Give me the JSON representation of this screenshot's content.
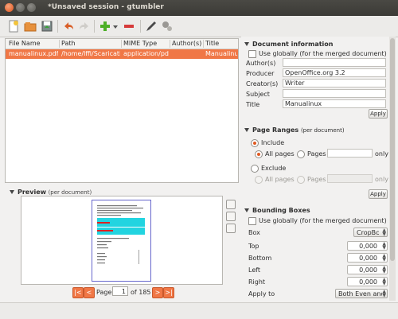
{
  "window": {
    "title": "*Unsaved session - gtumbler"
  },
  "toolbar": {
    "icons": [
      "new-icon",
      "open-icon",
      "save-icon",
      "undo-icon",
      "redo-icon",
      "add-icon",
      "add-menu-icon",
      "remove-icon",
      "edit-icon",
      "settings-icon"
    ]
  },
  "filelist": {
    "columns": [
      "File Name",
      "Path",
      "MIME Type",
      "Author(s)",
      "Title"
    ],
    "rows": [
      {
        "file": "manualinux.pdf",
        "path": "/home/lffi/Scaricati",
        "mime": "application/pdf",
        "author": "",
        "title": "Manualinux"
      }
    ]
  },
  "preview": {
    "label": "Preview",
    "note": "(per document)",
    "page_label": "Page",
    "page_value": "1",
    "of_label": "of 185"
  },
  "docinfo": {
    "header": "Document information",
    "use_globally": "Use globally (for the merged document)",
    "fields": [
      {
        "key": "Author(s)",
        "value": ""
      },
      {
        "key": "Producer",
        "value": "OpenOffice.org 3.2"
      },
      {
        "key": "Creator(s)",
        "value": "Writer"
      },
      {
        "key": "Subject",
        "value": ""
      },
      {
        "key": "Title",
        "value": "Manualinux"
      }
    ],
    "apply": "Apply"
  },
  "ranges": {
    "header": "Page Ranges",
    "note": "(per document)",
    "include": "Include",
    "all_pages": "All pages",
    "pages": "Pages",
    "only": "only",
    "exclude": "Exclude",
    "all_pages2": "All pages",
    "pages2": "Pages",
    "only2": "only",
    "apply": "Apply"
  },
  "bbox": {
    "header": "Bounding Boxes",
    "use_globally": "Use globally (for the merged document)",
    "box_label": "Box",
    "box_value": "CropBc",
    "top_label": "Top",
    "top_value": "0,000",
    "bottom_label": "Bottom",
    "bottom_value": "0,000",
    "left_label": "Left",
    "left_value": "0,000",
    "right_label": "Right",
    "right_value": "0,000",
    "apply_to_label": "Apply to",
    "apply_to_value": "Both Even anc"
  },
  "colors": {
    "accent": "#f07746",
    "titlebar": "#3c3b37",
    "desktop": "#7a1f3d"
  }
}
